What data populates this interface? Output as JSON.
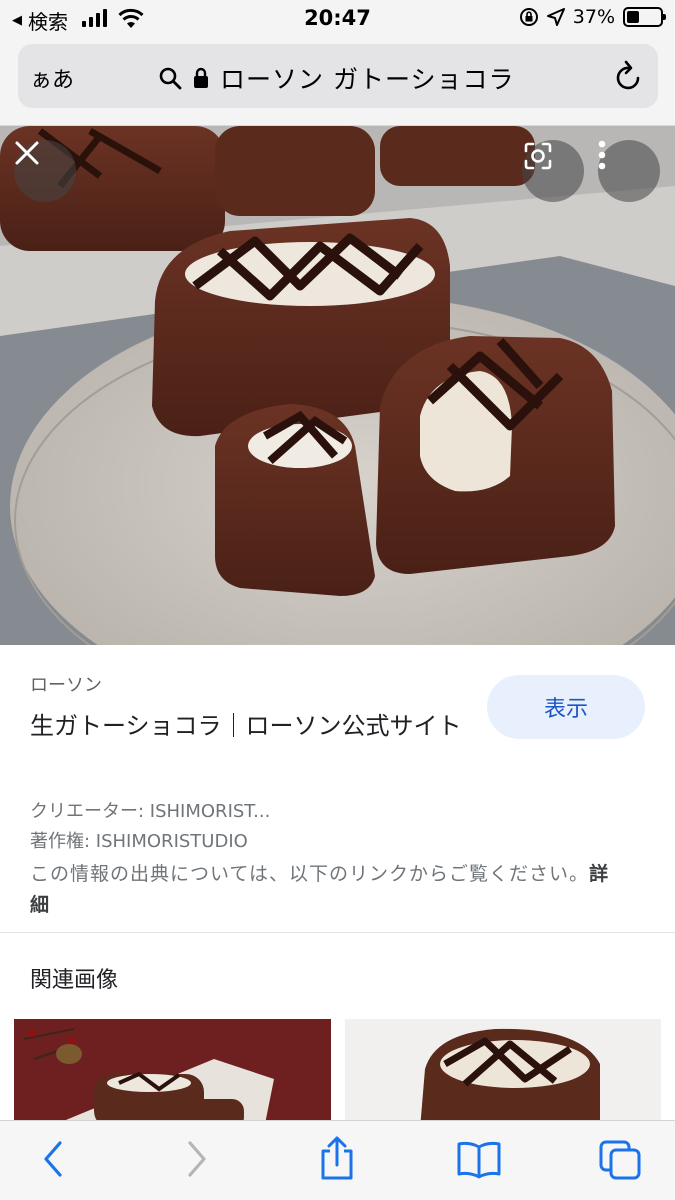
{
  "status_bar": {
    "back_app": "検索",
    "time": "20:47",
    "battery": "37%",
    "battery_level": 0.37
  },
  "browser": {
    "aa": "ぁあ",
    "url_text": "ローソン ガトーショコラ"
  },
  "result": {
    "source": "ローソン",
    "title": "生ガトーショコラ｜ローソン公式サイト",
    "view_button": "表示",
    "creator": "クリエーター: ISHIMORIST...",
    "copyright": "著作権: ISHIMORISTUDIO",
    "notice": "この情報の出典については、以下のリンクからご覧ください。",
    "notice_more": "詳細"
  },
  "related": {
    "heading": "関連画像"
  },
  "icons": {
    "close": "close-icon",
    "lens": "lens-icon",
    "more": "more-vertical-icon",
    "search": "search-icon",
    "lock": "lock-icon",
    "reload": "reload-icon",
    "back": "chevron-left-icon",
    "forward": "chevron-right-icon",
    "share": "share-icon",
    "bookmarks": "book-icon",
    "tabs": "tabs-icon"
  },
  "colors": {
    "accent": "#1a56c8",
    "view_button_bg": "#e8f0fe"
  }
}
